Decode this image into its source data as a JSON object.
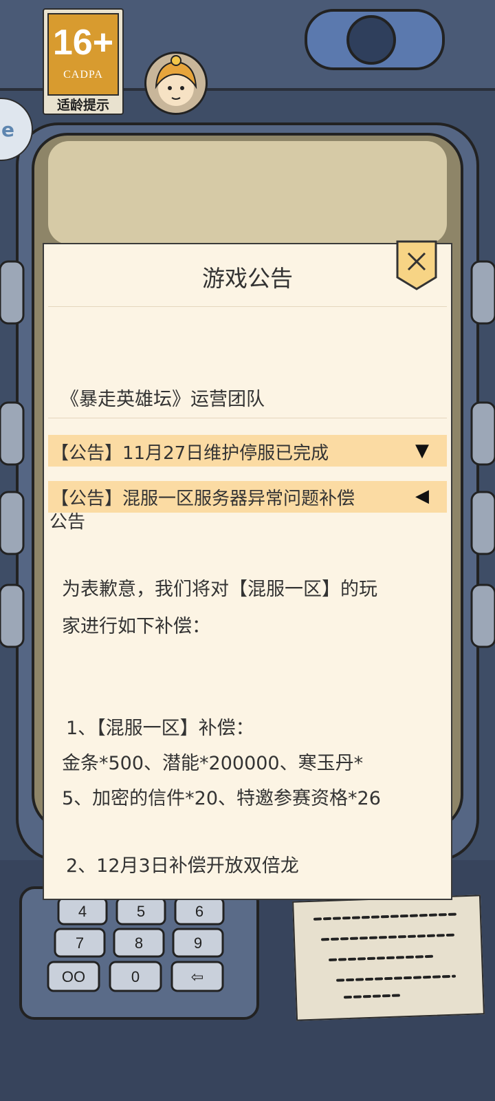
{
  "age_rating": {
    "number": "16+",
    "org": "CADPA",
    "tip": "适龄提示"
  },
  "notice": {
    "title": "游戏公告",
    "team": "《暴走英雄坛》运营团队",
    "announcements": [
      {
        "label": "【公告】11月27日维护停服已完成",
        "arrow": "▼"
      },
      {
        "label": "【公告】混服一区服务器异常问题补偿",
        "label_cont": "公告",
        "arrow": "◀"
      }
    ],
    "body": [
      "为表歉意，我们将对【混服一区】的玩",
      "家进行如下补偿：",
      "1、【混服一区】补偿：",
      "金条*500、潜能*200000、寒玉丹*",
      "5、加密的信件*20、特邀参赛资格*26",
      "2、12月3日补偿开放双倍龙"
    ]
  },
  "colors": {
    "panel": "#fcf4e4",
    "highlight": "#fbdba3",
    "badge": "#d89b2f",
    "background": "#3b4a63"
  },
  "icons": [
    "close-icon",
    "avatar-icon",
    "side-icon"
  ]
}
